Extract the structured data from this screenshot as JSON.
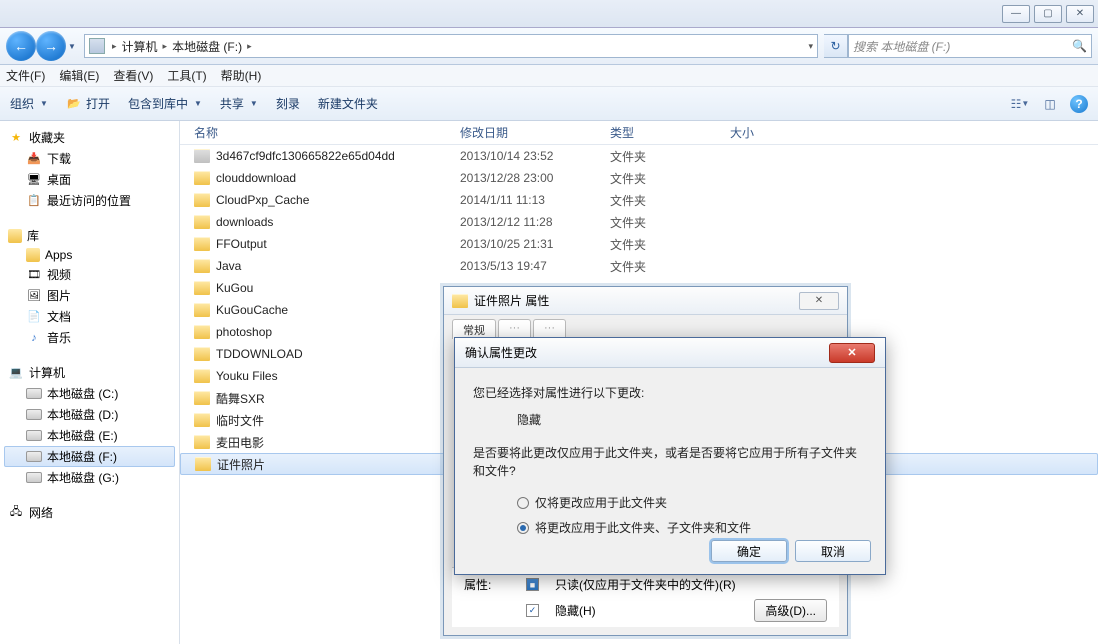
{
  "window": {
    "title": ""
  },
  "breadcrumb": {
    "computer": "计算机",
    "drive": "本地磁盘 (F:)"
  },
  "search": {
    "placeholder": "搜索 本地磁盘 (F:)"
  },
  "menu": {
    "file": "文件(F)",
    "edit": "编辑(E)",
    "view": "查看(V)",
    "tools": "工具(T)",
    "help": "帮助(H)"
  },
  "toolbar": {
    "organize": "组织",
    "open": "打开",
    "include": "包含到库中",
    "share": "共享",
    "burn": "刻录",
    "newfolder": "新建文件夹"
  },
  "columns": {
    "name": "名称",
    "date": "修改日期",
    "type": "类型",
    "size": "大小"
  },
  "sidebar": {
    "favorites": "收藏夹",
    "downloads": "下载",
    "desktop": "桌面",
    "recent": "最近访问的位置",
    "libraries": "库",
    "apps": "Apps",
    "videos": "视频",
    "pictures": "图片",
    "documents": "文档",
    "music": "音乐",
    "computer": "计算机",
    "drivec": "本地磁盘 (C:)",
    "drived": "本地磁盘 (D:)",
    "drivee": "本地磁盘 (E:)",
    "drivef": "本地磁盘 (F:)",
    "driveg": "本地磁盘 (G:)",
    "network": "网络"
  },
  "files": [
    {
      "name": "3d467cf9dfc130665822e65d04dd",
      "date": "2013/10/14 23:52",
      "type": "文件夹",
      "locked": true
    },
    {
      "name": "clouddownload",
      "date": "2013/12/28 23:00",
      "type": "文件夹"
    },
    {
      "name": "CloudPxp_Cache",
      "date": "2014/1/11 11:13",
      "type": "文件夹"
    },
    {
      "name": "downloads",
      "date": "2013/12/12 11:28",
      "type": "文件夹"
    },
    {
      "name": "FFOutput",
      "date": "2013/10/25 21:31",
      "type": "文件夹"
    },
    {
      "name": "Java",
      "date": "2013/5/13 19:47",
      "type": "文件夹"
    },
    {
      "name": "KuGou",
      "date": "",
      "type": ""
    },
    {
      "name": "KuGouCache",
      "date": "",
      "type": ""
    },
    {
      "name": "photoshop",
      "date": "",
      "type": ""
    },
    {
      "name": "TDDOWNLOAD",
      "date": "",
      "type": ""
    },
    {
      "name": "Youku Files",
      "date": "",
      "type": ""
    },
    {
      "name": "酷舞SXR",
      "date": "",
      "type": ""
    },
    {
      "name": "临时文件",
      "date": "",
      "type": ""
    },
    {
      "name": "麦田电影",
      "date": "",
      "type": ""
    },
    {
      "name": "证件照片",
      "date": "",
      "type": "",
      "selected": true
    }
  ],
  "props": {
    "title": "证件照片 属性",
    "tab_general": "常规",
    "attr_label": "属性:",
    "readonly": "只读(仅应用于文件夹中的文件)(R)",
    "hidden": "隐藏(H)",
    "advanced": "高级(D)..."
  },
  "confirm": {
    "title": "确认属性更改",
    "line1": "您已经选择对属性进行以下更改:",
    "hidden": "隐藏",
    "question": "是否要将此更改仅应用于此文件夹，或者是否要将它应用于所有子文件夹和文件?",
    "opt1": "仅将更改应用于此文件夹",
    "opt2": "将更改应用于此文件夹、子文件夹和文件",
    "ok": "确定",
    "cancel": "取消"
  }
}
